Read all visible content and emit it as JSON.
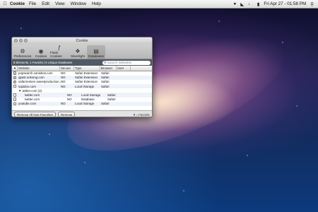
{
  "menubar": {
    "app": "Cookie",
    "items": [
      "File",
      "Edit",
      "View",
      "Window",
      "Help"
    ],
    "clock": "Fri Apr 27 - 01:58 PM",
    "icons": [
      "apple-icon",
      "user-icon",
      "wifi-icon",
      "volume-icon",
      "battery-icon",
      "search-icon"
    ]
  },
  "window": {
    "title": "Cookie",
    "toolbar": [
      {
        "label": "Preferences",
        "icon": "⚙"
      },
      {
        "label": "Cookies",
        "icon": "◉"
      },
      {
        "label": "Flash Cookies",
        "icon": "ƒ"
      },
      {
        "label": "Silverlight",
        "icon": "❖"
      },
      {
        "label": "Databases",
        "icon": "▤"
      }
    ],
    "info": "8 Elements, 1 Favorite | 8 Unique Databases",
    "search_placeholder": "Search Websites",
    "columns": [
      "Website",
      "Secure",
      "Type",
      "Browser",
      "User"
    ],
    "rows": [
      {
        "website": "popsearch.canisbos.com",
        "secure": "NO",
        "type": "Safari Extension",
        "browser": "Safari",
        "checked": true,
        "indent": false
      },
      {
        "website": "qjanit.ookiong.com",
        "secure": "NO",
        "type": "Safari Extension",
        "browser": "Safari",
        "checked": true,
        "indent": false
      },
      {
        "website": "safarirestore.sweetproduction...",
        "secure": "NO",
        "type": "Safari Extension",
        "browser": "Safari",
        "checked": true,
        "indent": false
      },
      {
        "website": "squidoo.com",
        "secure": "NO",
        "type": "Local Storage",
        "browser": "Safari",
        "checked": false,
        "indent": false
      },
      {
        "website": "▼ twitter.com (2)",
        "secure": "",
        "type": "",
        "browser": "",
        "checked": false,
        "indent": false
      },
      {
        "website": "twitter.com",
        "secure": "NO",
        "type": "Local Storage",
        "browser": "Safari",
        "checked": false,
        "indent": true
      },
      {
        "website": "twitter.com",
        "secure": "NO",
        "type": "Database",
        "browser": "Safari",
        "checked": false,
        "indent": true
      },
      {
        "website": "youtube.com",
        "secure": "NO",
        "type": "Local Storage",
        "browser": "Safari",
        "checked": false,
        "indent": false
      }
    ],
    "buttons": {
      "remove_all": "Remove All Non-Favorites",
      "remove": "Remove"
    },
    "legend": "= Favorite"
  }
}
